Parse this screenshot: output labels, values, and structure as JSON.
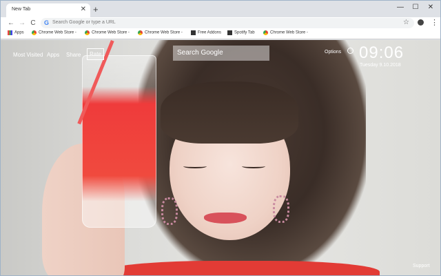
{
  "browser": {
    "tab_title": "New Tab",
    "tab_close": "✕",
    "new_tab": "+",
    "window_controls": {
      "minimize": "—",
      "maximize": "☐",
      "close": "✕"
    },
    "nav": {
      "back": "←",
      "forward": "→",
      "reload": "C"
    },
    "omnibox": {
      "google_g": "G",
      "placeholder": "Search Google or type a URL"
    },
    "icons": [
      "star-icon",
      "profile-icon",
      "menu-icon"
    ]
  },
  "bookmarks": [
    {
      "label": "Apps",
      "icon": "apps-grid-icon"
    },
    {
      "label": "Chrome Web Store -",
      "icon": "chrome-web-store-icon"
    },
    {
      "label": "Chrome Web Store -",
      "icon": "chrome-web-store-icon"
    },
    {
      "label": "Chrome Web Store -",
      "icon": "chrome-web-store-icon"
    },
    {
      "label": "Free Addons",
      "icon": "addon-icon"
    },
    {
      "label": "Spotify Tab",
      "icon": "addon-icon"
    },
    {
      "label": "Chrome Web Store -",
      "icon": "chrome-web-store-icon"
    }
  ],
  "newtab": {
    "links": {
      "most_visited": "Most Visited",
      "apps": "Apps",
      "share": "Share",
      "rate": "Rate"
    },
    "search_placeholder": "Search Google",
    "options": "Options",
    "clock": {
      "time": "09:06",
      "date": "Tuesday  9.10.2018"
    },
    "support": "Support"
  }
}
